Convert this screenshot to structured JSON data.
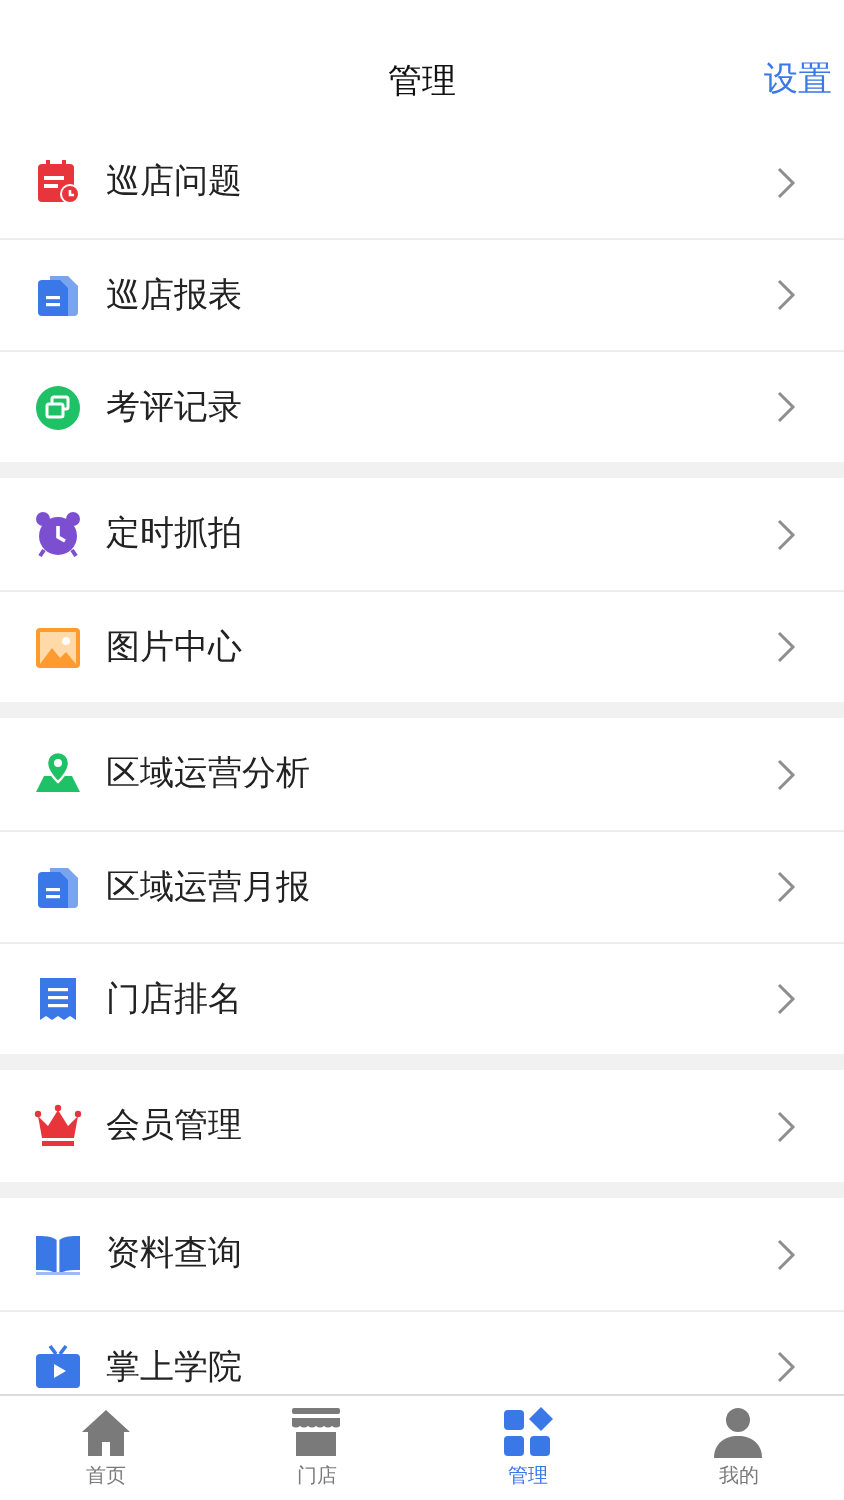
{
  "header": {
    "title": "管理",
    "action": "设置"
  },
  "groups": [
    {
      "items": [
        {
          "label": "巡店问题",
          "kind": "calendar"
        },
        {
          "label": "巡店报表",
          "kind": "document"
        },
        {
          "label": "考评记录",
          "kind": "review"
        }
      ]
    },
    {
      "items": [
        {
          "label": "定时抓拍",
          "kind": "alarm"
        },
        {
          "label": "图片中心",
          "kind": "image"
        }
      ]
    },
    {
      "items": [
        {
          "label": "区域运营分析",
          "kind": "map"
        },
        {
          "label": "区域运营月报",
          "kind": "document"
        },
        {
          "label": "门店排名",
          "kind": "receipt"
        }
      ]
    },
    {
      "items": [
        {
          "label": "会员管理",
          "kind": "crown"
        }
      ]
    },
    {
      "items": [
        {
          "label": "资料查询",
          "kind": "book"
        },
        {
          "label": "掌上学院",
          "kind": "tv"
        }
      ]
    }
  ],
  "tabs": [
    {
      "label": "首页",
      "kind": "home",
      "selected": false
    },
    {
      "label": "门店",
      "kind": "store",
      "selected": false
    },
    {
      "label": "管理",
      "kind": "grid",
      "selected": true
    },
    {
      "label": "我的",
      "kind": "person",
      "selected": false
    }
  ]
}
